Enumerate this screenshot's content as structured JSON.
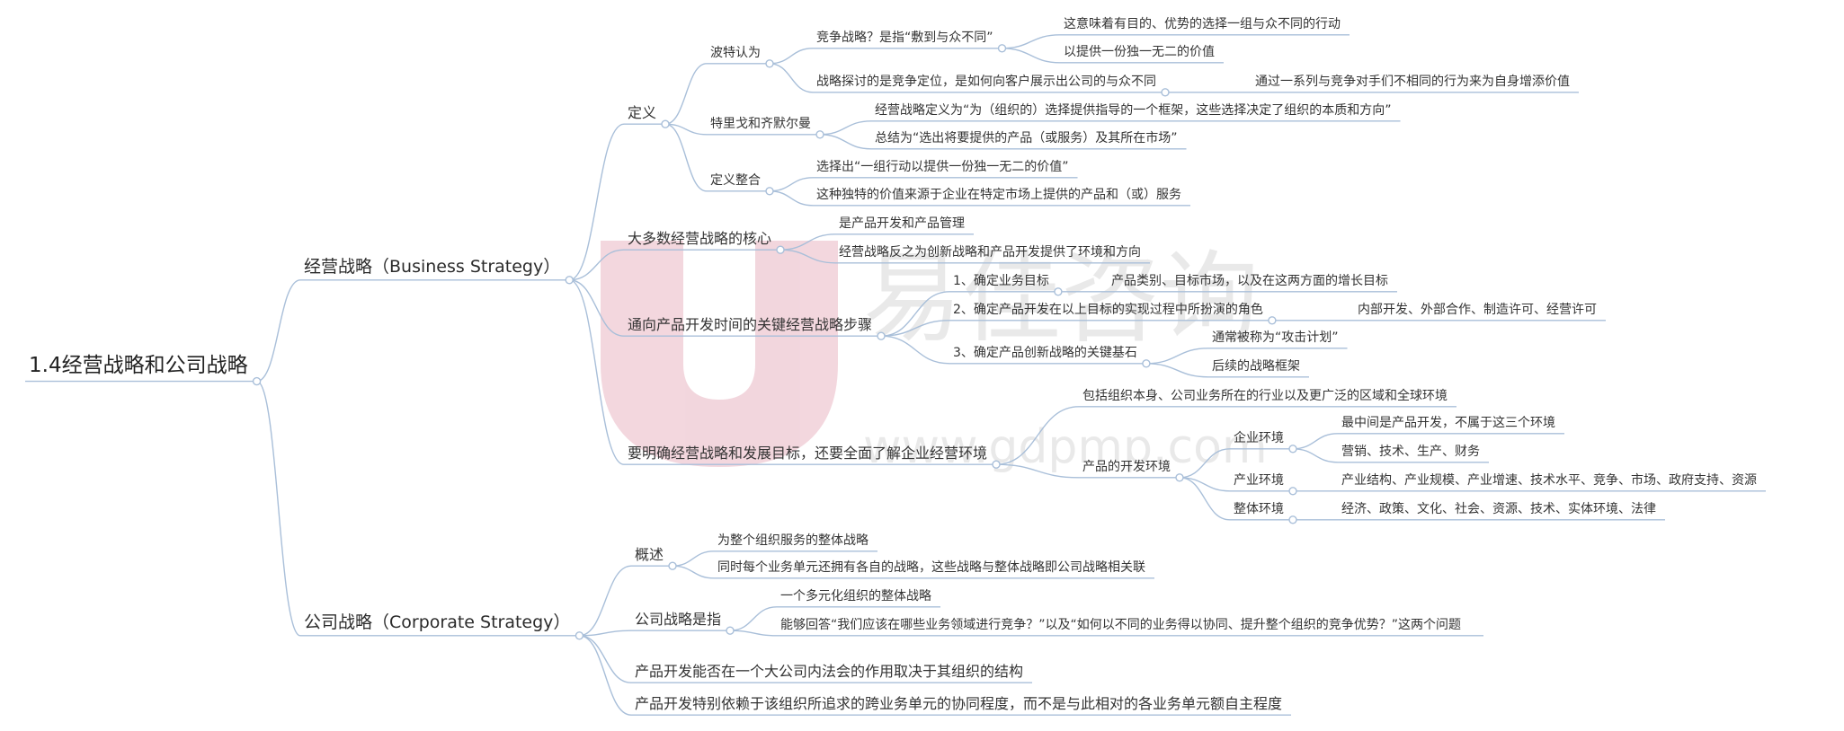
{
  "watermark": {
    "brand": "易佳咨询",
    "url": "www.gdpmp.com",
    "color": "#e9b6c2"
  },
  "colors": {
    "line": "#a9bfd9",
    "text": "#333333"
  },
  "root": {
    "text": "1.4经营战略和公司战略",
    "children": [
      {
        "text": "经营战略（Business Strategy）",
        "children": [
          {
            "text": "定义",
            "children": [
              {
                "text": "波特认为",
                "children": [
                  {
                    "text": "竞争战略？是指“敷到与众不同”",
                    "children": [
                      {
                        "text": "这意味着有目的、优势的选择一组与众不同的行动"
                      },
                      {
                        "text": "以提供一份独一无二的价值"
                      }
                    ]
                  },
                  {
                    "text": "战略探讨的是竞争定位，是如何向客户展示出公司的与众不同",
                    "children": [
                      {
                        "text": "通过一系列与竞争对手们不相同的行为来为自身增添价值"
                      }
                    ]
                  }
                ]
              },
              {
                "text": "特里戈和齐默尔曼",
                "children": [
                  {
                    "text": "经营战略定义为“为（组织的）选择提供指导的一个框架，这些选择决定了组织的本质和方向”"
                  },
                  {
                    "text": "总结为“选出将要提供的产品（或服务）及其所在市场”"
                  }
                ]
              },
              {
                "text": "定义整合",
                "children": [
                  {
                    "text": "选择出“一组行动以提供一份独一无二的价值”"
                  },
                  {
                    "text": "这种独特的价值来源于企业在特定市场上提供的产品和（或）服务"
                  }
                ]
              }
            ]
          },
          {
            "text": "大多数经营战略的核心",
            "children": [
              {
                "text": "是产品开发和产品管理"
              },
              {
                "text": "经营战略反之为创新战略和产品开发提供了环境和方向"
              }
            ]
          },
          {
            "text": "通向产品开发时间的关键经营战略步骤",
            "children": [
              {
                "text": "1、确定业务目标",
                "children": [
                  {
                    "text": "产品类别、目标市场，以及在这两方面的增长目标"
                  }
                ]
              },
              {
                "text": "2、确定产品开发在以上目标的实现过程中所扮演的角色",
                "children": [
                  {
                    "text": "内部开发、外部合作、制造许可、经营许可"
                  }
                ]
              },
              {
                "text": "3、确定产品创新战略的关键基石",
                "children": [
                  {
                    "text": "通常被称为“攻击计划”"
                  },
                  {
                    "text": "后续的战略框架"
                  }
                ]
              }
            ]
          },
          {
            "text": "要明确经营战略和发展目标，还要全面了解企业经营环境",
            "children": [
              {
                "text": "包括组织本身、公司业务所在的行业以及更广泛的区域和全球环境"
              },
              {
                "text": "产品的开发环境",
                "children": [
                  {
                    "text": "企业环境",
                    "children": [
                      {
                        "text": "最中间是产品开发，不属于这三个环境"
                      },
                      {
                        "text": "营销、技术、生产、财务"
                      }
                    ]
                  },
                  {
                    "text": "产业环境",
                    "children": [
                      {
                        "text": "产业结构、产业规模、产业增速、技术水平、竞争、市场、政府支持、资源"
                      }
                    ]
                  },
                  {
                    "text": "整体环境",
                    "children": [
                      {
                        "text": "经济、政策、文化、社会、资源、技术、实体环境、法律"
                      }
                    ]
                  }
                ]
              }
            ]
          }
        ]
      },
      {
        "text": "公司战略（Corporate Strategy）",
        "children": [
          {
            "text": "概述",
            "children": [
              {
                "text": "为整个组织服务的整体战略"
              },
              {
                "text": "同时每个业务单元还拥有各自的战略，这些战略与整体战略即公司战略相关联"
              }
            ]
          },
          {
            "text": "公司战略是指",
            "children": [
              {
                "text": "一个多元化组织的整体战略"
              },
              {
                "text": "能够回答“我们应该在哪些业务领域进行竞争？”以及“如何以不同的业务得以协同、提升整个组织的竞争优势？”这两个问题"
              }
            ]
          },
          {
            "text": "产品开发能否在一个大公司内法会的作用取决于其组织的结构"
          },
          {
            "text": "产品开发特别依赖于该组织所追求的跨业务单元的协同程度，而不是与此相对的各业务单元额自主程度"
          }
        ]
      }
    ]
  }
}
